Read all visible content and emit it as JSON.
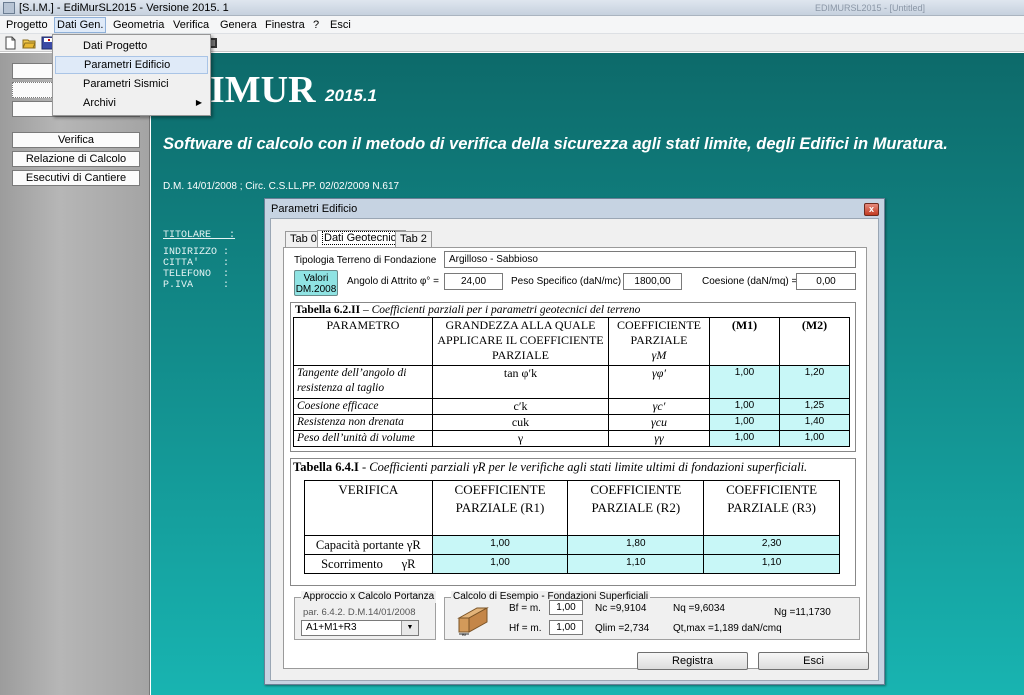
{
  "window": {
    "title": "[S.I.M.] - EdiMurSL2015 - Versione  2015. 1",
    "ghost_title": "EDIMURSL2015 - [Untitled]"
  },
  "menubar": [
    "Progetto",
    "Dati Gen.",
    "Geometria",
    "Verifica",
    "Genera",
    "Finestra",
    "?",
    "Esci"
  ],
  "dropdown": {
    "items": [
      "Dati Progetto",
      "Parametri Edificio",
      "Parametri Sismici",
      "Archivi"
    ],
    "highlighted": "Parametri Edificio",
    "submenu_arrow": "▶"
  },
  "left_buttons": {
    "arc": "Archivio",
    "par": "Parametri",
    "gen": "Generali",
    "verifica": "Verifica",
    "relazione": "Relazione di Calcolo",
    "esecutivi": "Esecutivi di Cantiere"
  },
  "hero": {
    "title": "IMUR",
    "version": "2015.1",
    "subtitle": "Software di calcolo con il metodo di verifica della sicurezza agli stati limite, degli Edifici in Muratura.",
    "reference": "D.M. 14/01/2008 ; Circ. C.S.LL.PP. 02/02/2009 N.617",
    "owner_titolare": "TITOLARE   :",
    "owner_fields": [
      "INDIRIZZO :",
      "CITTA'    :",
      "TELEFONO  :",
      "P.IVA     :"
    ]
  },
  "dialog": {
    "title": "Parametri Edificio",
    "close": "x",
    "tabs": [
      "Tab 0",
      "Dati Geotecnici",
      "Tab 2"
    ],
    "terrain_label": "Tipologia Terreno di Fondazione",
    "terrain_value": "Argilloso - Sabbioso",
    "valori_button": "Valori\nDM.2008",
    "attrito_label": "Angolo di Attrito  φ° =",
    "attrito_value": "24,00",
    "peso_label": "Peso Specifico (daN/mc)",
    "peso_value": "1800,00",
    "coesione_label": "Coesione (daN/mq) =",
    "coesione_value": "0,00",
    "table1": {
      "caption_num": "Tabella 6.2.II",
      "caption_text": " – Coefficienti parziali per i parametri geotecnici del terreno",
      "headers": [
        "PARAMETRO",
        "GRANDEZZA ALLA QUALE APPLICARE IL COEFFICIENTE PARZIALE",
        "COEFFICIENTE PARZIALE",
        "γM",
        "(M1)",
        "(M2)"
      ],
      "rows": [
        {
          "param": "Tangente dell’angolo di resistenza al taglio",
          "grandezza": "tan φ′k",
          "coeff": "γφ′",
          "m1": "1,00",
          "m2": "1,20"
        },
        {
          "param": "Coesione efficace",
          "grandezza": "c′k",
          "coeff": "γc′",
          "m1": "1,00",
          "m2": "1,25"
        },
        {
          "param": "Resistenza non drenata",
          "grandezza": "cuk",
          "coeff": "γcu",
          "m1": "1,00",
          "m2": "1,40"
        },
        {
          "param": "Peso dell’unità di volume",
          "grandezza": "γ",
          "coeff": "γγ",
          "m1": "1,00",
          "m2": "1,00"
        }
      ]
    },
    "table2": {
      "caption_num": "Tabella 6.4.I",
      "caption_text": " - Coefficienti parziali γR per le verifiche agli stati limite ultimi di fondazioni superficiali.",
      "headers": [
        "VERIFICA",
        "COEFFICIENTE PARZIALE (R1)",
        "COEFFICIENTE PARZIALE (R2)",
        "COEFFICIENTE PARZIALE (R3)"
      ],
      "rows": [
        {
          "label": "Capacità portante γR",
          "r1": "1,00",
          "r2": "1,80",
          "r3": "2,30"
        },
        {
          "label": "Scorrimento      γR",
          "r1": "1,00",
          "r2": "1,10",
          "r3": "1,10"
        }
      ]
    },
    "approccio": {
      "group_title": "Approccio x Calcolo Portanza",
      "ref": "par. 6.4.2. D.M.14/01/2008",
      "select_value": "A1+M1+R3"
    },
    "esempio": {
      "group_title": "Calcolo di Esempio - Fondazioni Superficiali",
      "bf_label": "Bf = m.",
      "bf_value": "1,00",
      "hf_label": "Hf = m.",
      "hf_value": "1,00",
      "nc": "Nc  =9,9104",
      "nq": "Nq       =9,6034",
      "ng": "Ng =11,1730",
      "qlim": "Qlim  =2,734",
      "qtmax": "Qt,max =1,189  daN/cmq",
      "img_label_b": "Bf"
    },
    "buttons": {
      "registra": "Registra",
      "esci": "Esci"
    }
  }
}
